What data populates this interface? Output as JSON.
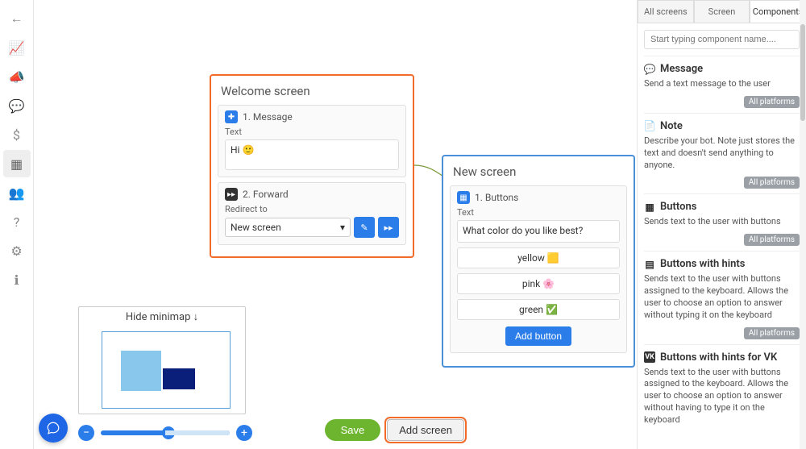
{
  "sidebar": [
    {
      "name": "back-icon",
      "glyph": "←"
    },
    {
      "name": "stats-icon",
      "glyph": "📈"
    },
    {
      "name": "broadcast-icon",
      "glyph": "📣"
    },
    {
      "name": "chat-icon",
      "glyph": "💬"
    },
    {
      "name": "dollar-icon",
      "glyph": "$"
    },
    {
      "name": "flow-icon",
      "glyph": "▦",
      "active": true
    },
    {
      "name": "users-icon",
      "glyph": "👥"
    },
    {
      "name": "help-icon",
      "glyph": "?"
    },
    {
      "name": "settings-icon",
      "glyph": "⚙"
    },
    {
      "name": "info-icon",
      "glyph": "ℹ"
    }
  ],
  "welcome": {
    "title": "Welcome screen",
    "message_section": {
      "header": "1. Message",
      "label": "Text",
      "value": "Hi  🙂"
    },
    "forward_section": {
      "header": "2. Forward",
      "label": "Redirect to",
      "selected": "New screen",
      "caret": "▾"
    }
  },
  "new_screen": {
    "title": "New screen",
    "buttons_section": {
      "header": "1. Buttons",
      "label": "Text",
      "value": "What  color do you like best?",
      "options": [
        "yellow 🟨",
        "pink 🌸",
        "green ✅"
      ],
      "add_label": "Add button"
    }
  },
  "minimap": {
    "title": "Hide minimap ↓"
  },
  "bottom": {
    "save": "Save",
    "add_screen": "Add screen"
  },
  "right_panel": {
    "tabs": [
      "All screens",
      "Screen",
      "Components"
    ],
    "active_tab": 2,
    "search_placeholder": "Start typing component name....",
    "components": [
      {
        "icon": "💬",
        "title": "Message",
        "desc": "Send a text message to the user",
        "badge": "All platforms"
      },
      {
        "icon": "📄",
        "title": "Note",
        "desc": "Describe your bot. Note just stores the text and doesn't send anything to anyone.",
        "badge": "All platforms"
      },
      {
        "icon": "▦",
        "title": "Buttons",
        "desc": "Sends text to the user with buttons",
        "badge": "All platforms"
      },
      {
        "icon": "▤",
        "title": "Buttons with hints",
        "desc": "Sends text to the user with buttons assigned to the keyboard. Allows the user to choose an option to answer without typing it on the keyboard",
        "badge": "All platforms"
      },
      {
        "icon": "VK",
        "title": "Buttons with hints for VK",
        "desc": "Sends text to the user with buttons assigned to the keyboard. Allows the user to choose an option to answer without having to type it on the keyboard",
        "badge": ""
      }
    ]
  }
}
